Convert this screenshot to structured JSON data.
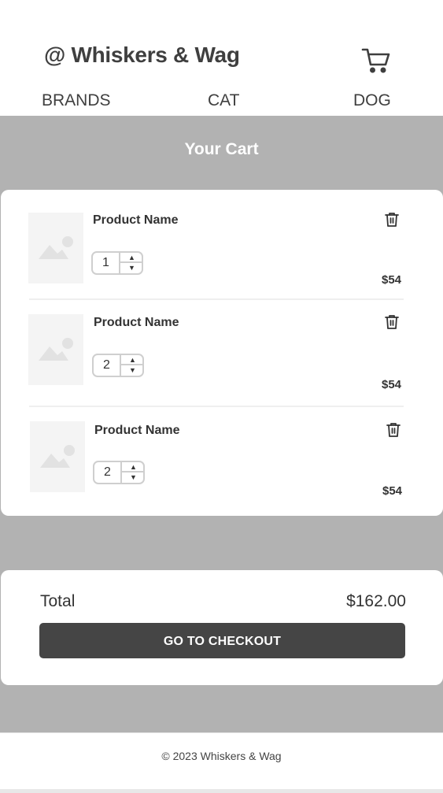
{
  "header": {
    "logo": "@ Whiskers & Wag",
    "cart_icon": "shopping-cart-icon",
    "nav": [
      {
        "label": "BRANDS"
      },
      {
        "label": "CAT"
      },
      {
        "label": "DOG"
      }
    ]
  },
  "cart": {
    "title": "Your Cart",
    "items": [
      {
        "name": "Product Name",
        "quantity": "1",
        "price": "$54",
        "image_icon": "image-placeholder-icon"
      },
      {
        "name": "Product Name",
        "quantity": "2",
        "price": "$54",
        "image_icon": "image-placeholder-icon"
      },
      {
        "name": "Product Name",
        "quantity": "2",
        "price": "$54",
        "image_icon": "image-placeholder-icon"
      }
    ]
  },
  "summary": {
    "total_label": "Total",
    "total_value": "$162.00",
    "checkout_label": "GO TO CHECKOUT"
  },
  "footer": {
    "copyright": "© 2023 Whiskers & Wag"
  },
  "colors": {
    "main_bg": "#b2b2b2",
    "button_bg": "#454545",
    "text": "#3d3d3d"
  }
}
